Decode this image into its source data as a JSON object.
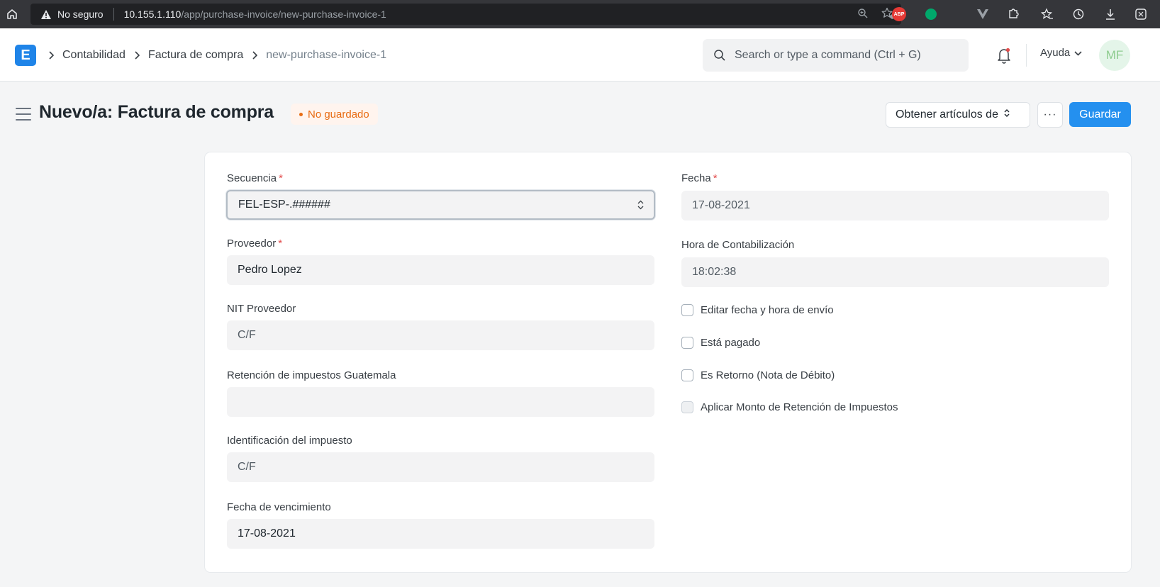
{
  "browser": {
    "security_label": "No seguro",
    "url_host": "10.155.1.110",
    "url_path": "/app/purchase-invoice/new-purchase-invoice-1",
    "extension_abp": "ABP"
  },
  "navbar": {
    "logo_letter": "E",
    "breadcrumbs": [
      "Contabilidad",
      "Factura de compra",
      "new-purchase-invoice-1"
    ],
    "search_placeholder": "Search or type a command (Ctrl + G)",
    "help_label": "Ayuda",
    "avatar_initials": "MF"
  },
  "page": {
    "title": "Nuevo/a: Factura de compra",
    "status": "No guardado",
    "get_items_label": "Obtener artículos de",
    "more_label": "···",
    "save_label": "Guardar"
  },
  "form": {
    "left": {
      "naming_series": {
        "label": "Secuencia",
        "value": "FEL-ESP-.######"
      },
      "supplier": {
        "label": "Proveedor",
        "value": "Pedro Lopez"
      },
      "supplier_nit": {
        "label": "NIT Proveedor",
        "value": "C/F"
      },
      "tax_withholding": {
        "label": "Retención de impuestos Guatemala",
        "value": ""
      },
      "tax_id": {
        "label": "Identificación del impuesto",
        "value": "C/F"
      },
      "due_date": {
        "label": "Fecha de vencimiento",
        "value": "17-08-2021"
      }
    },
    "right": {
      "posting_date": {
        "label": "Fecha",
        "value": "17-08-2021"
      },
      "posting_time": {
        "label": "Hora de Contabilización",
        "value": "18:02:38"
      },
      "checks": [
        {
          "label": "Editar fecha y hora de envío",
          "checked": false,
          "disabled": false
        },
        {
          "label": "Está pagado",
          "checked": false,
          "disabled": false
        },
        {
          "label": "Es Retorno (Nota de Débito)",
          "checked": false,
          "disabled": false
        },
        {
          "label": "Aplicar Monto de Retención de Impuestos",
          "checked": false,
          "disabled": true
        }
      ]
    },
    "required_mark": "*"
  },
  "colors": {
    "primary": "#2490ef",
    "status_orange": "#e86c13",
    "required_red": "#e24c4c"
  }
}
